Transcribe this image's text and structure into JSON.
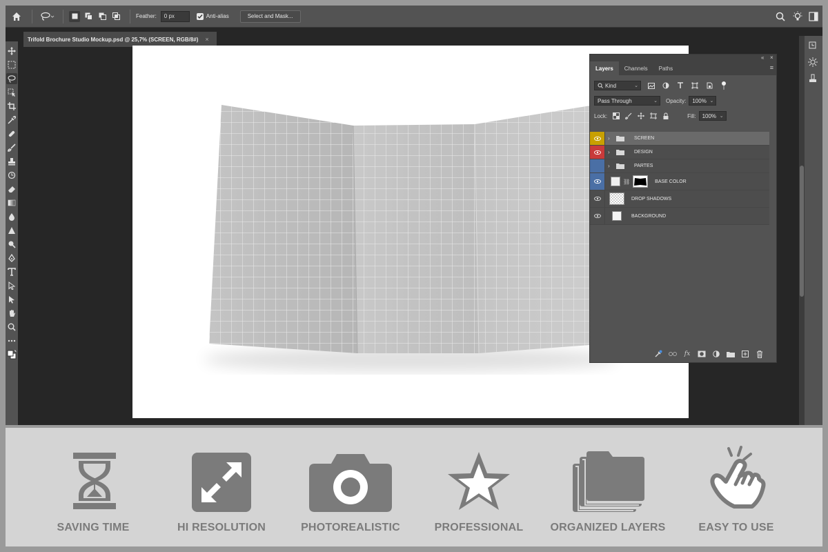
{
  "options_bar": {
    "feather_label": "Feather:",
    "feather_value": "0 px",
    "antialias_label": "Anti-alias",
    "antialias_checked": true,
    "select_mask_label": "Select and Mask..."
  },
  "document_tab": {
    "title": "Trifold Brochure Studio Mockup.psd @ 25,7% (SCREEN, RGB/8#)",
    "close": "×"
  },
  "layers_panel": {
    "collapse_glyph": "«",
    "close_glyph": "×",
    "tabs": [
      {
        "label": "Layers",
        "active": true
      },
      {
        "label": "Channels",
        "active": false
      },
      {
        "label": "Paths",
        "active": false
      }
    ],
    "filter_kind": "Kind",
    "blend_mode": "Pass Through",
    "opacity_label": "Opacity:",
    "opacity_value": "100%",
    "lock_label": "Lock:",
    "fill_label": "Fill:",
    "fill_value": "100%",
    "layers": [
      {
        "name": "SCREEN",
        "type": "group",
        "color": "#c8a000",
        "visible": true,
        "selected": true
      },
      {
        "name": "DESIGN",
        "type": "group",
        "color": "#c83a3a",
        "visible": true,
        "selected": false
      },
      {
        "name": "PARTES",
        "type": "group",
        "color": "#4a6fa5",
        "visible": false,
        "selected": false
      },
      {
        "name": "BASE COLOR",
        "type": "masked",
        "color": "#4a6fa5",
        "visible": true,
        "selected": false
      },
      {
        "name": "DROP SHADOWS",
        "type": "transparent",
        "color": "",
        "visible": true,
        "selected": false
      },
      {
        "name": "BACKGROUND",
        "type": "white",
        "color": "",
        "visible": true,
        "selected": false
      }
    ],
    "footer_fx": "fx"
  },
  "features": [
    {
      "label": "SAVING TIME",
      "icon": "hourglass-icon"
    },
    {
      "label": "HI RESOLUTION",
      "icon": "expand-arrows-icon"
    },
    {
      "label": "PHOTOREALISTIC",
      "icon": "camera-icon"
    },
    {
      "label": "PROFESSIONAL",
      "icon": "star-icon"
    },
    {
      "label": "ORGANIZED LAYERS",
      "icon": "stacked-folders-icon"
    },
    {
      "label": "EASY TO USE",
      "icon": "tapping-hand-icon"
    }
  ],
  "colors": {
    "workspace": "#262626",
    "panel": "#535353",
    "feature_bar": "#d4d4d4",
    "feature_icon": "#7b7b7b"
  }
}
